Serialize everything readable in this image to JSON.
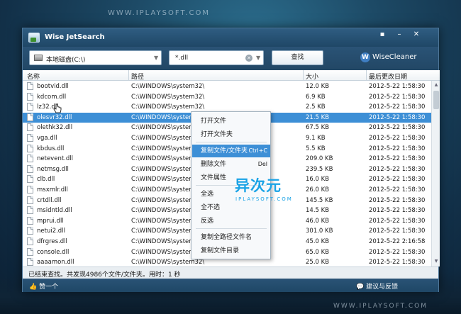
{
  "watermarks": {
    "top": "WWW.IPLAYSOFT.COM",
    "bottom": "WWW.IPLAYSOFT.COM"
  },
  "window": {
    "title": "Wise JetSearch",
    "controls": [
      "▪",
      "–",
      "✕"
    ]
  },
  "toolbar": {
    "drive": "本地磁盘(C:\\)",
    "filter": "*.dll",
    "search_label": "查找",
    "brand": "WiseCleaner",
    "brand_logo": "W"
  },
  "table": {
    "headers": [
      "名称",
      "路径",
      "大小",
      "最后更改日期"
    ],
    "rows": [
      {
        "name": "bootvid.dll",
        "path": "C:\\WINDOWS\\system32\\",
        "size": "12.0 KB",
        "date": "2012-5-22 1:58:30"
      },
      {
        "name": "kdcom.dll",
        "path": "C:\\WINDOWS\\system32\\",
        "size": "6.9 KB",
        "date": "2012-5-22 1:58:30"
      },
      {
        "name": "lz32.dll",
        "path": "C:\\WINDOWS\\system32\\",
        "size": "2.5 KB",
        "date": "2012-5-22 1:58:30"
      },
      {
        "name": "olesvr32.dll",
        "path": "C:\\WINDOWS\\system32\\",
        "size": "21.5 KB",
        "date": "2012-5-22 1:58:30",
        "selected": true
      },
      {
        "name": "olethk32.dll",
        "path": "C:\\WINDOWS\\system32\\",
        "size": "67.5 KB",
        "date": "2012-5-22 1:58:30"
      },
      {
        "name": "vga.dll",
        "path": "C:\\WINDOWS\\system32\\",
        "size": "9.1 KB",
        "date": "2012-5-22 1:58:30"
      },
      {
        "name": "kbdus.dll",
        "path": "C:\\WINDOWS\\system32\\",
        "size": "5.5 KB",
        "date": "2012-5-22 1:58:30"
      },
      {
        "name": "netevent.dll",
        "path": "C:\\WINDOWS\\system32\\",
        "size": "209.0 KB",
        "date": "2012-5-22 1:58:30"
      },
      {
        "name": "netmsg.dll",
        "path": "C:\\WINDOWS\\system32\\",
        "size": "239.5 KB",
        "date": "2012-5-22 1:58:30"
      },
      {
        "name": "clb.dll",
        "path": "C:\\WINDOWS\\system32\\",
        "size": "16.0 KB",
        "date": "2012-5-22 1:58:30"
      },
      {
        "name": "msxmlr.dll",
        "path": "C:\\WINDOWS\\system32\\",
        "size": "26.0 KB",
        "date": "2012-5-22 1:58:30"
      },
      {
        "name": "crtdll.dll",
        "path": "C:\\WINDOWS\\system32\\",
        "size": "145.5 KB",
        "date": "2012-5-22 1:58:30"
      },
      {
        "name": "msidntld.dll",
        "path": "C:\\WINDOWS\\system32\\",
        "size": "14.5 KB",
        "date": "2012-5-22 1:58:30"
      },
      {
        "name": "mprui.dll",
        "path": "C:\\WINDOWS\\system32\\",
        "size": "46.0 KB",
        "date": "2012-5-22 1:58:30"
      },
      {
        "name": "netui2.dll",
        "path": "C:\\WINDOWS\\system32\\",
        "size": "301.0 KB",
        "date": "2012-5-22 1:58:30"
      },
      {
        "name": "dfrgres.dll",
        "path": "C:\\WINDOWS\\system32\\",
        "size": "45.0 KB",
        "date": "2012-5-22 2:16:58"
      },
      {
        "name": "console.dll",
        "path": "C:\\WINDOWS\\system32\\",
        "size": "65.0 KB",
        "date": "2012-5-22 1:58:30"
      },
      {
        "name": "aaaamon.dll",
        "path": "C:\\WINDOWS\\system32\\",
        "size": "25.0 KB",
        "date": "2012-5-22 1:58:30"
      }
    ]
  },
  "context_menu": {
    "items": [
      {
        "label": "打开文件",
        "shortcut": ""
      },
      {
        "label": "打开文件夹",
        "shortcut": ""
      },
      {
        "label": "复制文件/文件夹",
        "shortcut": "Ctrl+C",
        "highlighted": true
      },
      {
        "label": "删除文件",
        "shortcut": "Del"
      },
      {
        "label": "文件属性",
        "shortcut": ""
      },
      {
        "label": "全选",
        "shortcut": ""
      },
      {
        "label": "全不选",
        "shortcut": ""
      },
      {
        "label": "反选",
        "shortcut": ""
      },
      {
        "label": "复制全路径文件名",
        "shortcut": ""
      },
      {
        "label": "复制文件目录",
        "shortcut": ""
      }
    ]
  },
  "status": {
    "text": "已结束查找。共发现4986个文件/文件夹。用时：1 秒"
  },
  "footer": {
    "like": "赞一个",
    "feedback": "建议与反馈"
  },
  "overlay": {
    "logo_text": "异次元",
    "logo_sub": "IPLAYSOFT.COM"
  },
  "colors": {
    "titlebar": "#2f5d82",
    "selection": "#3d8fd6",
    "logo_accent": "#1aa3e6"
  }
}
